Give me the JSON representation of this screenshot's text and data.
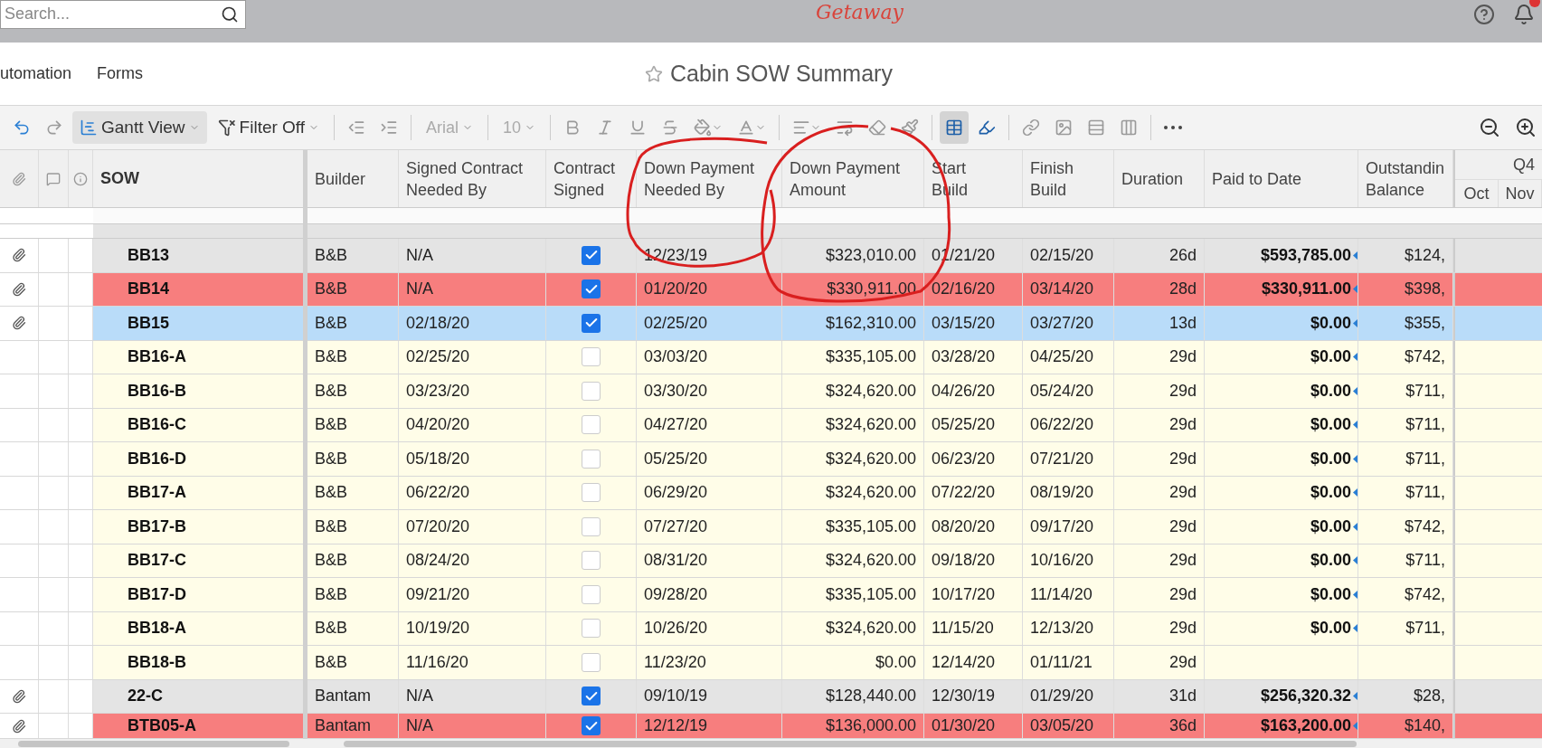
{
  "topbar": {
    "search": {
      "placeholder": "Search..."
    },
    "logo": "Getaway"
  },
  "nav": {
    "tabs": [
      "utomation",
      "Forms"
    ],
    "title": "Cabin SOW Summary"
  },
  "toolbar": {
    "view": "Gantt View",
    "filter": "Filter Off",
    "font": "Arial",
    "size": "10",
    "grid_selected": true
  },
  "table": {
    "columns": [
      "SOW",
      "Builder",
      "Signed Contract Needed By",
      "Contract Signed",
      "Down Payment Needed By",
      "Down Payment Amount",
      "Start Build",
      "Finish Build",
      "Duration",
      "Paid to Date",
      "Outstandin Balance"
    ],
    "gantt": {
      "quarter": "Q4",
      "months": [
        "Oct",
        "Nov"
      ]
    },
    "rows": [
      {
        "sow": "BB13",
        "builder": "B&B",
        "signed_by": "N/A",
        "contract_signed": true,
        "dp_needed_by": "12/23/19",
        "dp_amount": "$323,010.00",
        "start": "01/21/20",
        "finish": "02/15/20",
        "duration": "26d",
        "paid": "$593,785.00",
        "outstanding": "$124,",
        "attachment": true,
        "color": "#e4e4e4"
      },
      {
        "sow": "BB14",
        "builder": "B&B",
        "signed_by": "N/A",
        "contract_signed": true,
        "dp_needed_by": "01/20/20",
        "dp_amount": "$330,911.00",
        "start": "02/16/20",
        "finish": "03/14/20",
        "duration": "28d",
        "paid": "$330,911.00",
        "outstanding": "$398,",
        "attachment": true,
        "color": "#f77e7e"
      },
      {
        "sow": "BB15",
        "builder": "B&B",
        "signed_by": "02/18/20",
        "contract_signed": true,
        "dp_needed_by": "02/25/20",
        "dp_amount": "$162,310.00",
        "start": "03/15/20",
        "finish": "03/27/20",
        "duration": "13d",
        "paid": "$0.00",
        "outstanding": "$355,",
        "attachment": true,
        "color": "#b9dcf9"
      },
      {
        "sow": "BB16-A",
        "builder": "B&B",
        "signed_by": "02/25/20",
        "contract_signed": false,
        "dp_needed_by": "03/03/20",
        "dp_amount": "$335,105.00",
        "start": "03/28/20",
        "finish": "04/25/20",
        "duration": "29d",
        "paid": "$0.00",
        "outstanding": "$742,",
        "attachment": false,
        "color": "#fffde8"
      },
      {
        "sow": "BB16-B",
        "builder": "B&B",
        "signed_by": "03/23/20",
        "contract_signed": false,
        "dp_needed_by": "03/30/20",
        "dp_amount": "$324,620.00",
        "start": "04/26/20",
        "finish": "05/24/20",
        "duration": "29d",
        "paid": "$0.00",
        "outstanding": "$711,",
        "attachment": false,
        "color": "#fffde8"
      },
      {
        "sow": "BB16-C",
        "builder": "B&B",
        "signed_by": "04/20/20",
        "contract_signed": false,
        "dp_needed_by": "04/27/20",
        "dp_amount": "$324,620.00",
        "start": "05/25/20",
        "finish": "06/22/20",
        "duration": "29d",
        "paid": "$0.00",
        "outstanding": "$711,",
        "attachment": false,
        "color": "#fffde8"
      },
      {
        "sow": "BB16-D",
        "builder": "B&B",
        "signed_by": "05/18/20",
        "contract_signed": false,
        "dp_needed_by": "05/25/20",
        "dp_amount": "$324,620.00",
        "start": "06/23/20",
        "finish": "07/21/20",
        "duration": "29d",
        "paid": "$0.00",
        "outstanding": "$711,",
        "attachment": false,
        "color": "#fffde8"
      },
      {
        "sow": "BB17-A",
        "builder": "B&B",
        "signed_by": "06/22/20",
        "contract_signed": false,
        "dp_needed_by": "06/29/20",
        "dp_amount": "$324,620.00",
        "start": "07/22/20",
        "finish": "08/19/20",
        "duration": "29d",
        "paid": "$0.00",
        "outstanding": "$711,",
        "attachment": false,
        "color": "#fffde8"
      },
      {
        "sow": "BB17-B",
        "builder": "B&B",
        "signed_by": "07/20/20",
        "contract_signed": false,
        "dp_needed_by": "07/27/20",
        "dp_amount": "$335,105.00",
        "start": "08/20/20",
        "finish": "09/17/20",
        "duration": "29d",
        "paid": "$0.00",
        "outstanding": "$742,",
        "attachment": false,
        "color": "#fffde8"
      },
      {
        "sow": "BB17-C",
        "builder": "B&B",
        "signed_by": "08/24/20",
        "contract_signed": false,
        "dp_needed_by": "08/31/20",
        "dp_amount": "$324,620.00",
        "start": "09/18/20",
        "finish": "10/16/20",
        "duration": "29d",
        "paid": "$0.00",
        "outstanding": "$711,",
        "attachment": false,
        "color": "#fffde8"
      },
      {
        "sow": "BB17-D",
        "builder": "B&B",
        "signed_by": "09/21/20",
        "contract_signed": false,
        "dp_needed_by": "09/28/20",
        "dp_amount": "$335,105.00",
        "start": "10/17/20",
        "finish": "11/14/20",
        "duration": "29d",
        "paid": "$0.00",
        "outstanding": "$742,",
        "attachment": false,
        "color": "#fffde8"
      },
      {
        "sow": "BB18-A",
        "builder": "B&B",
        "signed_by": "10/19/20",
        "contract_signed": false,
        "dp_needed_by": "10/26/20",
        "dp_amount": "$324,620.00",
        "start": "11/15/20",
        "finish": "12/13/20",
        "duration": "29d",
        "paid": "$0.00",
        "outstanding": "$711,",
        "attachment": false,
        "color": "#fffde8"
      },
      {
        "sow": "BB18-B",
        "builder": "B&B",
        "signed_by": "11/16/20",
        "contract_signed": false,
        "dp_needed_by": "11/23/20",
        "dp_amount": "$0.00",
        "start": "12/14/20",
        "finish": "01/11/21",
        "duration": "29d",
        "attachment": false,
        "color": "#fffde8"
      },
      {
        "sow": "22-C",
        "builder": "Bantam",
        "signed_by": "N/A",
        "contract_signed": true,
        "dp_needed_by": "09/10/19",
        "dp_amount": "$128,440.00",
        "start": "12/30/19",
        "finish": "01/29/20",
        "duration": "31d",
        "paid": "$256,320.32",
        "outstanding": "$28,",
        "attachment": true,
        "color": "#e4e4e4"
      },
      {
        "sow": "BTB05-A",
        "builder": "Bantam",
        "signed_by": "N/A",
        "contract_signed": true,
        "dp_needed_by": "12/12/19",
        "dp_amount": "$136,000.00",
        "start": "01/30/20",
        "finish": "03/05/20",
        "duration": "36d",
        "paid": "$163,200.00",
        "outstanding": "$140,",
        "attachment": true,
        "color": "#f77e7e"
      }
    ]
  }
}
